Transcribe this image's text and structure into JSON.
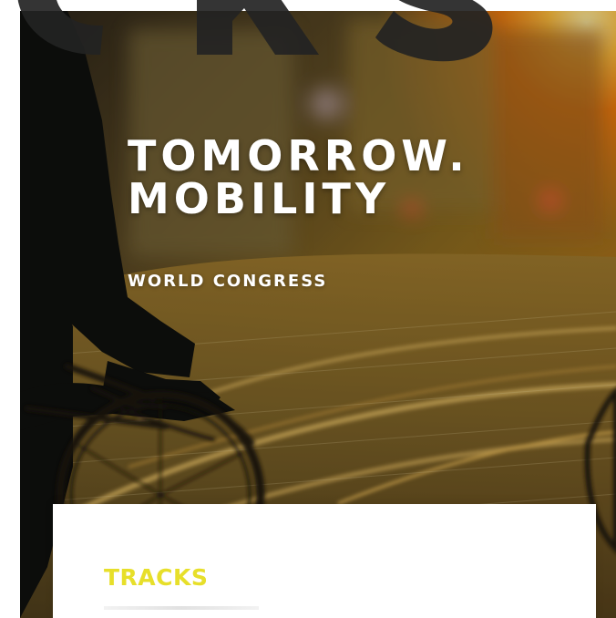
{
  "hero": {
    "title_line_1": "TOMORROW.",
    "title_line_2": "MOBILITY",
    "subtitle": "WORLD CONGRESS"
  },
  "tracks": {
    "heading": "TRACKS"
  },
  "colors": {
    "accent": "#e7df2a",
    "hero_orange": "#ff8d1f",
    "hero_dark": "#5f4a1d"
  },
  "icons": {
    "watermark": "logo-watermark-icon"
  }
}
